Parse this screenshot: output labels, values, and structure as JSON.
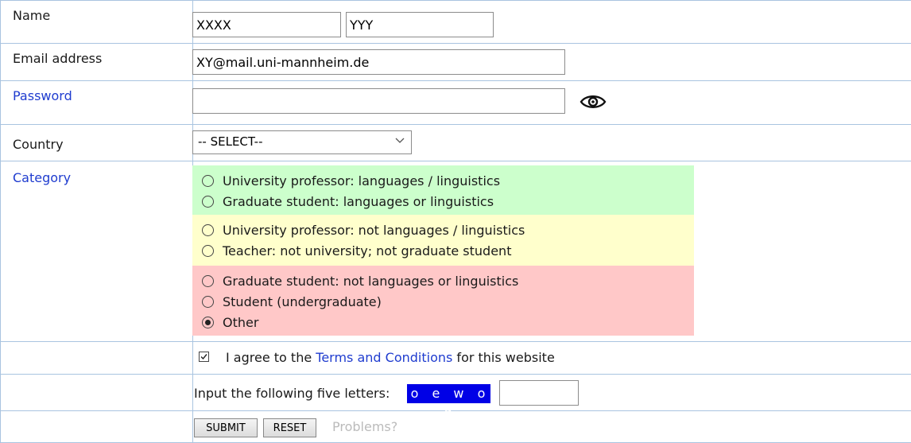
{
  "labels": {
    "name": "Name",
    "email": "Email address",
    "password": "Password",
    "country": "Country",
    "category": "Category"
  },
  "fields": {
    "first_name": "XXXX",
    "last_name": "YYY",
    "email": "XY@mail.uni-mannheim.de",
    "password": "",
    "country_selected": "-- SELECT--"
  },
  "category_groups": [
    {
      "color": "#ccffcc",
      "options": [
        {
          "label": "University professor: languages / linguistics",
          "selected": false
        },
        {
          "label": "Graduate student: languages or linguistics",
          "selected": false
        }
      ]
    },
    {
      "color": "#ffffcc",
      "options": [
        {
          "label": "University professor: not languages / linguistics",
          "selected": false
        },
        {
          "label": "Teacher: not university; not graduate student",
          "selected": false
        }
      ]
    },
    {
      "color": "#ffc8c8",
      "options": [
        {
          "label": "Graduate student: not languages or linguistics",
          "selected": false
        },
        {
          "label": "Student (undergraduate)",
          "selected": false
        },
        {
          "label": "Other",
          "selected": true
        }
      ]
    }
  ],
  "terms": {
    "checked": true,
    "prefix": "I agree to the ",
    "link": "Terms and Conditions",
    "suffix": " for this website"
  },
  "captcha": {
    "label": "Input the following five letters:",
    "letters": "oewoq",
    "input": ""
  },
  "buttons": {
    "submit": "SUBMIT",
    "reset": "RESET",
    "problems": "Problems?"
  },
  "icons": {
    "eye": "eye-icon",
    "chevron": "chevron-down-icon",
    "check": "check-icon"
  },
  "colors": {
    "label_accent": "#1f3ccf",
    "grid_line": "#a9c4e0",
    "captcha_bg": "#0000e6"
  }
}
